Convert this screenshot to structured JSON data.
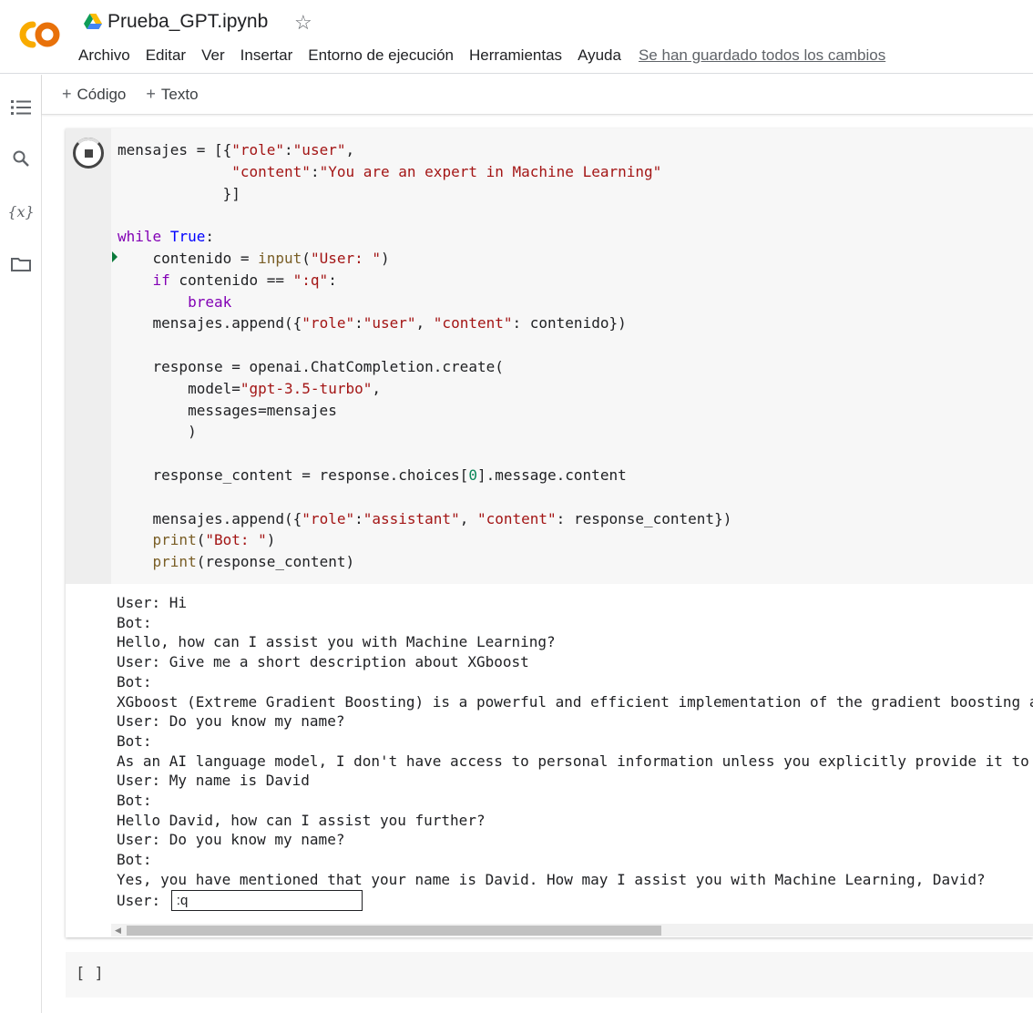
{
  "header": {
    "title": "Prueba_GPT.ipynb",
    "logo_text": "CO",
    "menu": [
      "Archivo",
      "Editar",
      "Ver",
      "Insertar",
      "Entorno de ejecución",
      "Herramientas",
      "Ayuda"
    ],
    "save_status": "Se han guardado todos los cambios"
  },
  "toolbar": {
    "add_code": "Código",
    "add_text": "Texto"
  },
  "rail": {
    "vars_glyph": "{x}"
  },
  "cell1": {
    "code_lines": [
      "mensajes = [{\"role\":\"user\",",
      "             \"content\":\"You are an expert in Machine Learning\"",
      "            }]",
      "",
      "while True:",
      "    contenido = input(\"User: \")",
      "    if contenido == \":q\":",
      "        break",
      "    mensajes.append({\"role\":\"user\", \"content\": contenido})",
      "",
      "    response = openai.ChatCompletion.create(",
      "        model=\"gpt-3.5-turbo\",",
      "        messages=mensajes",
      "        )",
      "",
      "    response_content = response.choices[0].message.content",
      "",
      "    mensajes.append({\"role\":\"assistant\", \"content\": response_content})",
      "    print(\"Bot: \")",
      "    print(response_content)"
    ],
    "output_lines": [
      "User: Hi",
      "Bot:",
      "Hello, how can I assist you with Machine Learning?",
      "User: Give me a short description about XGboost",
      "Bot:",
      "XGboost (Extreme Gradient Boosting) is a powerful and efficient implementation of the gradient boosting a",
      "User: Do you know my name?",
      "Bot:",
      "As an AI language model, I don't have access to personal information unless you explicitly provide it to",
      "User: My name is David",
      "Bot:",
      "Hello David, how can I assist you further?",
      "User: Do you know my name?",
      "Bot:",
      "Yes, you have mentioned that your name is David. How may I assist you with Machine Learning, David?"
    ],
    "stdin_label": "User: ",
    "stdin_value": ":q"
  },
  "cell2": {
    "bracket": "[ ]"
  }
}
